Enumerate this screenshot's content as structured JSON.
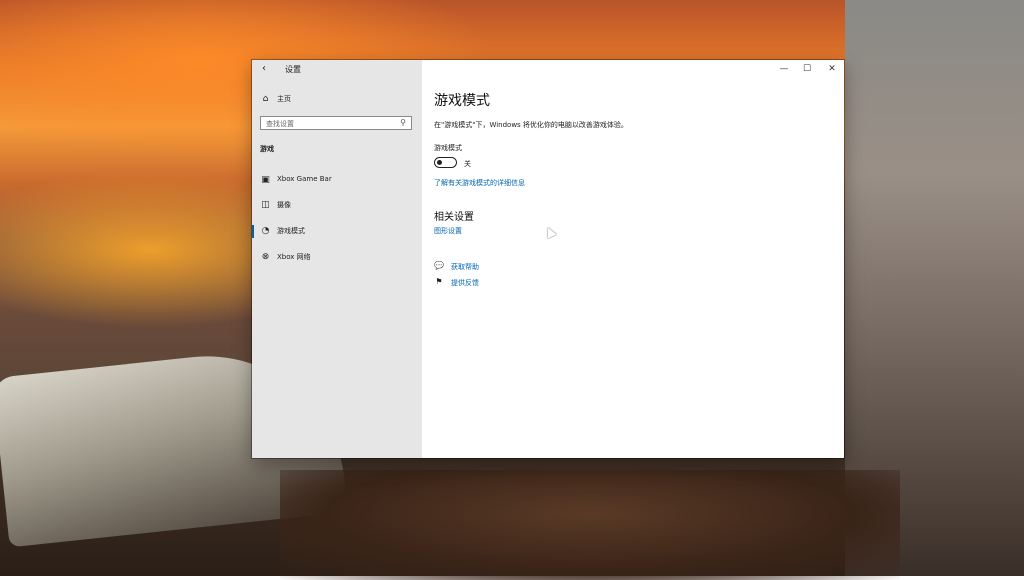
{
  "window": {
    "back_icon": "back-arrow-icon",
    "title": "设置",
    "controls": {
      "minimize": "—",
      "maximize": "☐",
      "close": "✕"
    }
  },
  "sidebar": {
    "home_icon": "home-icon",
    "home_label": "主页",
    "search": {
      "placeholder": "查找设置",
      "icon": "search-icon"
    },
    "section_label": "游戏",
    "items": [
      {
        "label": "Xbox Game Bar",
        "icon": "xbox-game-bar-icon"
      },
      {
        "label": "摄像",
        "icon": "capture-icon"
      },
      {
        "label": "游戏模式",
        "icon": "game-mode-icon",
        "active": true
      },
      {
        "label": "Xbox 网络",
        "icon": "xbox-icon"
      }
    ]
  },
  "main": {
    "title": "游戏模式",
    "description": "在\"游戏模式\"下，Windows 将优化你的电脑以改善游戏体验。",
    "toggle": {
      "caption": "游戏模式",
      "state_label": "关",
      "on": false
    },
    "learn_more_link": "了解有关游戏模式的详细信息",
    "related_settings": {
      "title": "相关设置",
      "link": "图形设置"
    },
    "help_links": [
      {
        "label": "获取帮助",
        "icon": "help-icon"
      },
      {
        "label": "提供反馈",
        "icon": "feedback-icon"
      }
    ]
  },
  "colors": {
    "accent": "#0066b4",
    "sidebar_bg": "#e6e6e6"
  }
}
